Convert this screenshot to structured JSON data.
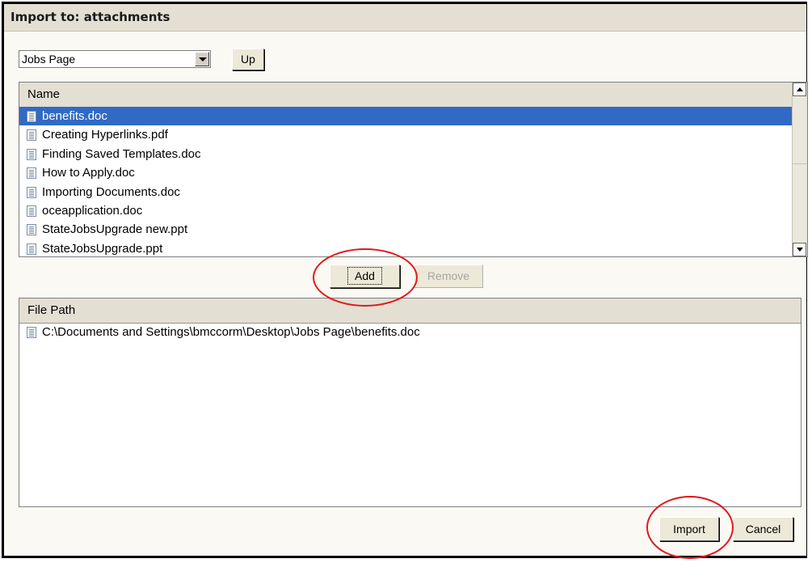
{
  "dialog": {
    "title": "Import to: attachments"
  },
  "folder_select": {
    "selected": "Jobs Page"
  },
  "toolbar": {
    "up_label": "Up"
  },
  "source_list": {
    "header": "Name",
    "items": [
      {
        "label": "benefits.doc",
        "selected": true,
        "icon": "document-icon"
      },
      {
        "label": "Creating Hyperlinks.pdf",
        "icon": "document-icon"
      },
      {
        "label": "Finding Saved Templates.doc",
        "icon": "document-icon"
      },
      {
        "label": "How to Apply.doc",
        "icon": "document-icon"
      },
      {
        "label": "Importing Documents.doc",
        "icon": "document-icon"
      },
      {
        "label": "oceapplication.doc",
        "icon": "document-icon"
      },
      {
        "label": "StateJobsUpgrade new.ppt",
        "icon": "document-icon"
      },
      {
        "label": "StateJobsUpgrade.ppt",
        "icon": "document-icon"
      }
    ]
  },
  "actions": {
    "add_label": "Add",
    "remove_label": "Remove"
  },
  "path_list": {
    "header": "File Path",
    "items": [
      {
        "label": "C:\\Documents and Settings\\bmccorm\\Desktop\\Jobs Page\\benefits.doc",
        "icon": "document-icon"
      }
    ]
  },
  "footer": {
    "import_label": "Import",
    "cancel_label": "Cancel"
  },
  "colors": {
    "selection": "#316ac5",
    "annotation": "#e0181b",
    "header_bg": "#e4dfd3"
  }
}
